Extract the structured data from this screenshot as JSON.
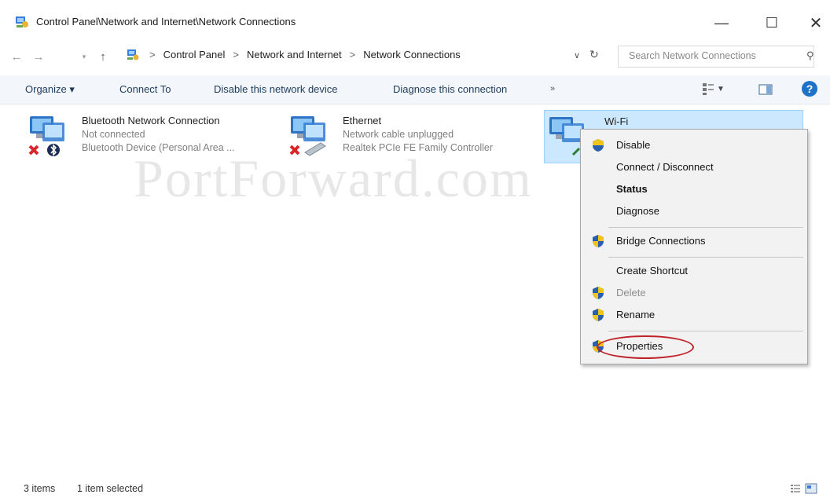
{
  "window": {
    "title": "Control Panel\\Network and Internet\\Network Connections",
    "controls": [
      "—",
      "☐",
      "✕"
    ]
  },
  "address": {
    "crumbs": [
      "Control Panel",
      "Network and Internet",
      "Network Connections"
    ],
    "separator": ">",
    "search_placeholder": "Search Network Connections"
  },
  "commands": {
    "organize": "Organize ▾",
    "connect_to": "Connect To",
    "disable_device": "Disable this network device",
    "diagnose": "Diagnose this connection",
    "more": "»"
  },
  "connections": [
    {
      "name": "Bluetooth Network Connection",
      "status": "Not connected",
      "device": "Bluetooth Device (Personal Area ..."
    },
    {
      "name": "Ethernet",
      "status": "Network cable unplugged",
      "device": "Realtek PCIe FE Family Controller"
    },
    {
      "name": "Wi-Fi",
      "selected": true
    }
  ],
  "context_menu": [
    {
      "label": "Disable",
      "shield": true
    },
    {
      "label": "Connect / Disconnect"
    },
    {
      "label": "Status",
      "bold": true
    },
    {
      "label": "Diagnose"
    },
    {
      "label": "Bridge Connections",
      "shield": true
    },
    {
      "label": "Create Shortcut"
    },
    {
      "label": "Delete",
      "shield": true,
      "disabled": true
    },
    {
      "label": "Rename",
      "shield": true
    },
    {
      "label": "Properties",
      "shield": true,
      "highlighted": true
    }
  ],
  "watermark": "PortForward.com",
  "status": {
    "count": "3 items",
    "selected": "1 item selected"
  },
  "colors": {
    "selection_bg": "#cce8ff",
    "highlight_ring": "#c0222a",
    "help_blue": "#1e73c8"
  }
}
